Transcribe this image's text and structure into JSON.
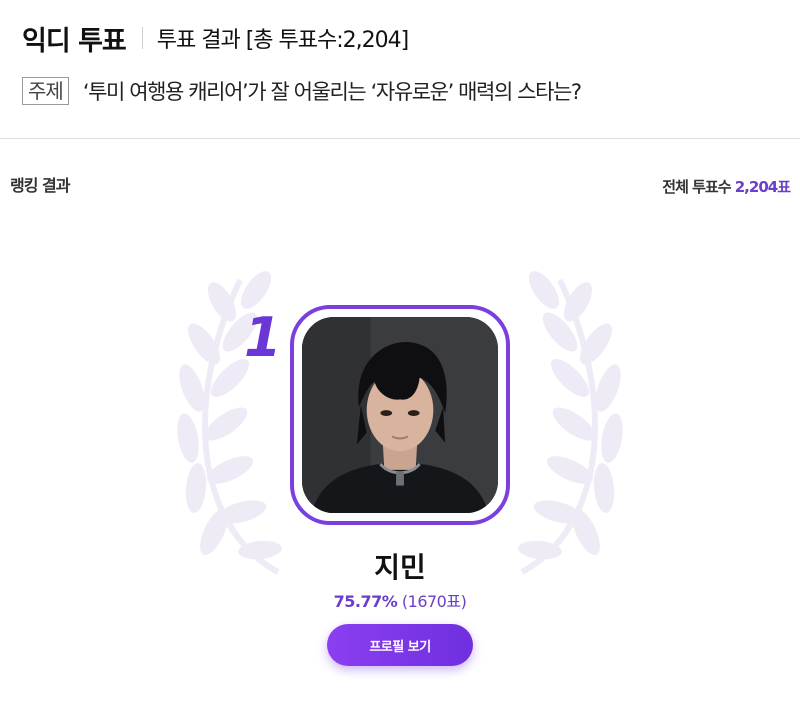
{
  "header": {
    "brand": "익디 투표",
    "result_title": "투표 결과 [총 투표수:2,204]"
  },
  "topic": {
    "tag": "주제",
    "text": "‘투미 여행용 캐리어’가 잘 어울리는 ‘자유로운’ 매력의 스타는?"
  },
  "ranking": {
    "label": "랭킹 결과",
    "total_prefix": "전체 투표수",
    "total_value": "2,204표"
  },
  "winner": {
    "rank": "1",
    "name": "지민",
    "percent": "75.77%",
    "count": "(1670표)"
  },
  "buttons": {
    "profile": "프로필 보기"
  },
  "colors": {
    "accent": "#6a3fc9",
    "button": "#7a35e8",
    "wreath": "#eeebf6"
  }
}
